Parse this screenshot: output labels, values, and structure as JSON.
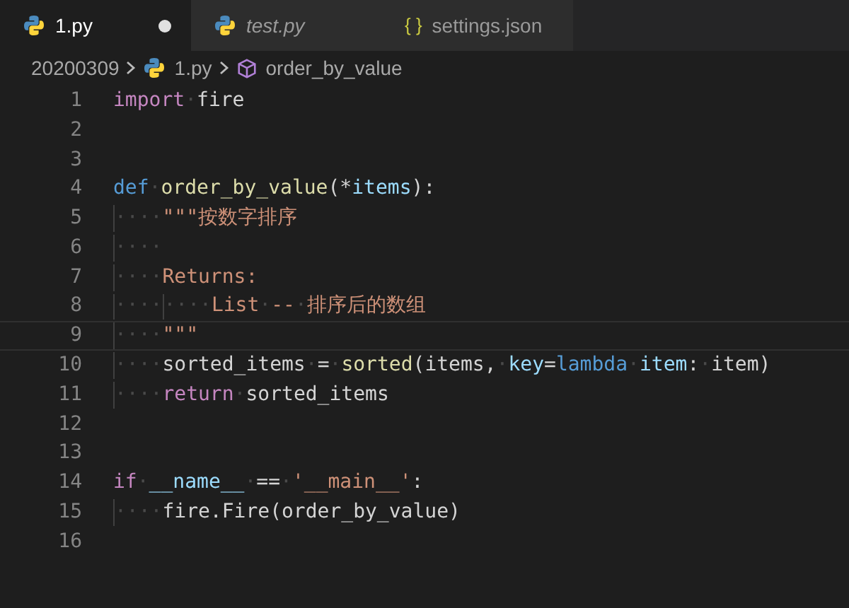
{
  "tabs": [
    {
      "kind": "python",
      "label": "1.py",
      "selected": true,
      "preview": false,
      "modified": true
    },
    {
      "kind": "python",
      "label": "test.py",
      "selected": false,
      "preview": true,
      "modified": false
    },
    {
      "kind": "json",
      "icon_text": "{ }",
      "label": "settings.json",
      "selected": false,
      "preview": false,
      "modified": false
    }
  ],
  "breadcrumbs": [
    {
      "kind": "folder",
      "label": "20200309"
    },
    {
      "kind": "python",
      "label": "1.py"
    },
    {
      "kind": "symbol",
      "label": "order_by_value"
    }
  ],
  "lines": [
    {
      "number": "1",
      "current": false,
      "tokens": [
        {
          "kind": "kw",
          "text": "import"
        },
        {
          "kind": "ws",
          "text": "·"
        },
        {
          "kind": "plain",
          "text": "fire"
        }
      ]
    },
    {
      "number": "2",
      "current": false
    },
    {
      "number": "3",
      "current": false
    },
    {
      "number": "4",
      "current": false,
      "tokens": [
        {
          "kind": "def",
          "text": "def"
        },
        {
          "kind": "ws",
          "text": "·"
        },
        {
          "kind": "fn",
          "text": "order_by_value"
        },
        {
          "kind": "plain",
          "text": "(*"
        },
        {
          "kind": "var",
          "text": "items"
        },
        {
          "kind": "plain",
          "text": "):"
        }
      ]
    },
    {
      "number": "5",
      "current": false,
      "tokens": [
        {
          "kind": "indent",
          "text": "····"
        },
        {
          "kind": "str",
          "text": "\"\"\"按数字排序"
        }
      ]
    },
    {
      "number": "6",
      "current": false,
      "tokens": [
        {
          "kind": "indent",
          "text": "····"
        }
      ]
    },
    {
      "number": "7",
      "current": false,
      "tokens": [
        {
          "kind": "indent",
          "text": "····"
        },
        {
          "kind": "str",
          "text": "Returns:"
        }
      ]
    },
    {
      "number": "8",
      "current": false,
      "tokens": [
        {
          "kind": "indent",
          "text": "····"
        },
        {
          "kind": "indent",
          "text": "····"
        },
        {
          "kind": "str",
          "text": "List"
        },
        {
          "kind": "ws",
          "text": "·"
        },
        {
          "kind": "str",
          "text": "--"
        },
        {
          "kind": "ws",
          "text": "·"
        },
        {
          "kind": "str",
          "text": "排序后的数组"
        }
      ]
    },
    {
      "number": "9",
      "current": true,
      "tokens": [
        {
          "kind": "indent",
          "text": "····"
        },
        {
          "kind": "str",
          "text": "\"\"\""
        }
      ]
    },
    {
      "number": "10",
      "current": false,
      "tokens": [
        {
          "kind": "indent",
          "text": "····"
        },
        {
          "kind": "plain",
          "text": "sorted_items"
        },
        {
          "kind": "ws",
          "text": "·"
        },
        {
          "kind": "plain",
          "text": "="
        },
        {
          "kind": "ws",
          "text": "·"
        },
        {
          "kind": "fn",
          "text": "sorted"
        },
        {
          "kind": "plain",
          "text": "(items,"
        },
        {
          "kind": "ws",
          "text": "·"
        },
        {
          "kind": "var",
          "text": "key"
        },
        {
          "kind": "plain",
          "text": "="
        },
        {
          "kind": "def",
          "text": "lambda"
        },
        {
          "kind": "ws",
          "text": "·"
        },
        {
          "kind": "var",
          "text": "item"
        },
        {
          "kind": "plain",
          "text": ":"
        },
        {
          "kind": "ws",
          "text": "·"
        },
        {
          "kind": "plain",
          "text": "item)"
        }
      ]
    },
    {
      "number": "11",
      "current": false,
      "tokens": [
        {
          "kind": "indent",
          "text": "····"
        },
        {
          "kind": "kw",
          "text": "return"
        },
        {
          "kind": "ws",
          "text": "·"
        },
        {
          "kind": "plain",
          "text": "sorted_items"
        }
      ]
    },
    {
      "number": "12",
      "current": false
    },
    {
      "number": "13",
      "current": false
    },
    {
      "number": "14",
      "current": false,
      "tokens": [
        {
          "kind": "kw",
          "text": "if"
        },
        {
          "kind": "ws",
          "text": "·"
        },
        {
          "kind": "var",
          "text": "__name__"
        },
        {
          "kind": "ws",
          "text": "·"
        },
        {
          "kind": "plain",
          "text": "=="
        },
        {
          "kind": "ws",
          "text": "·"
        },
        {
          "kind": "str",
          "text": "'__main__'"
        },
        {
          "kind": "plain",
          "text": ":"
        }
      ]
    },
    {
      "number": "15",
      "current": false,
      "tokens": [
        {
          "kind": "indent",
          "text": "····"
        },
        {
          "kind": "plain",
          "text": "fire.Fire(order_by_value)"
        }
      ]
    },
    {
      "number": "16",
      "current": false
    }
  ]
}
